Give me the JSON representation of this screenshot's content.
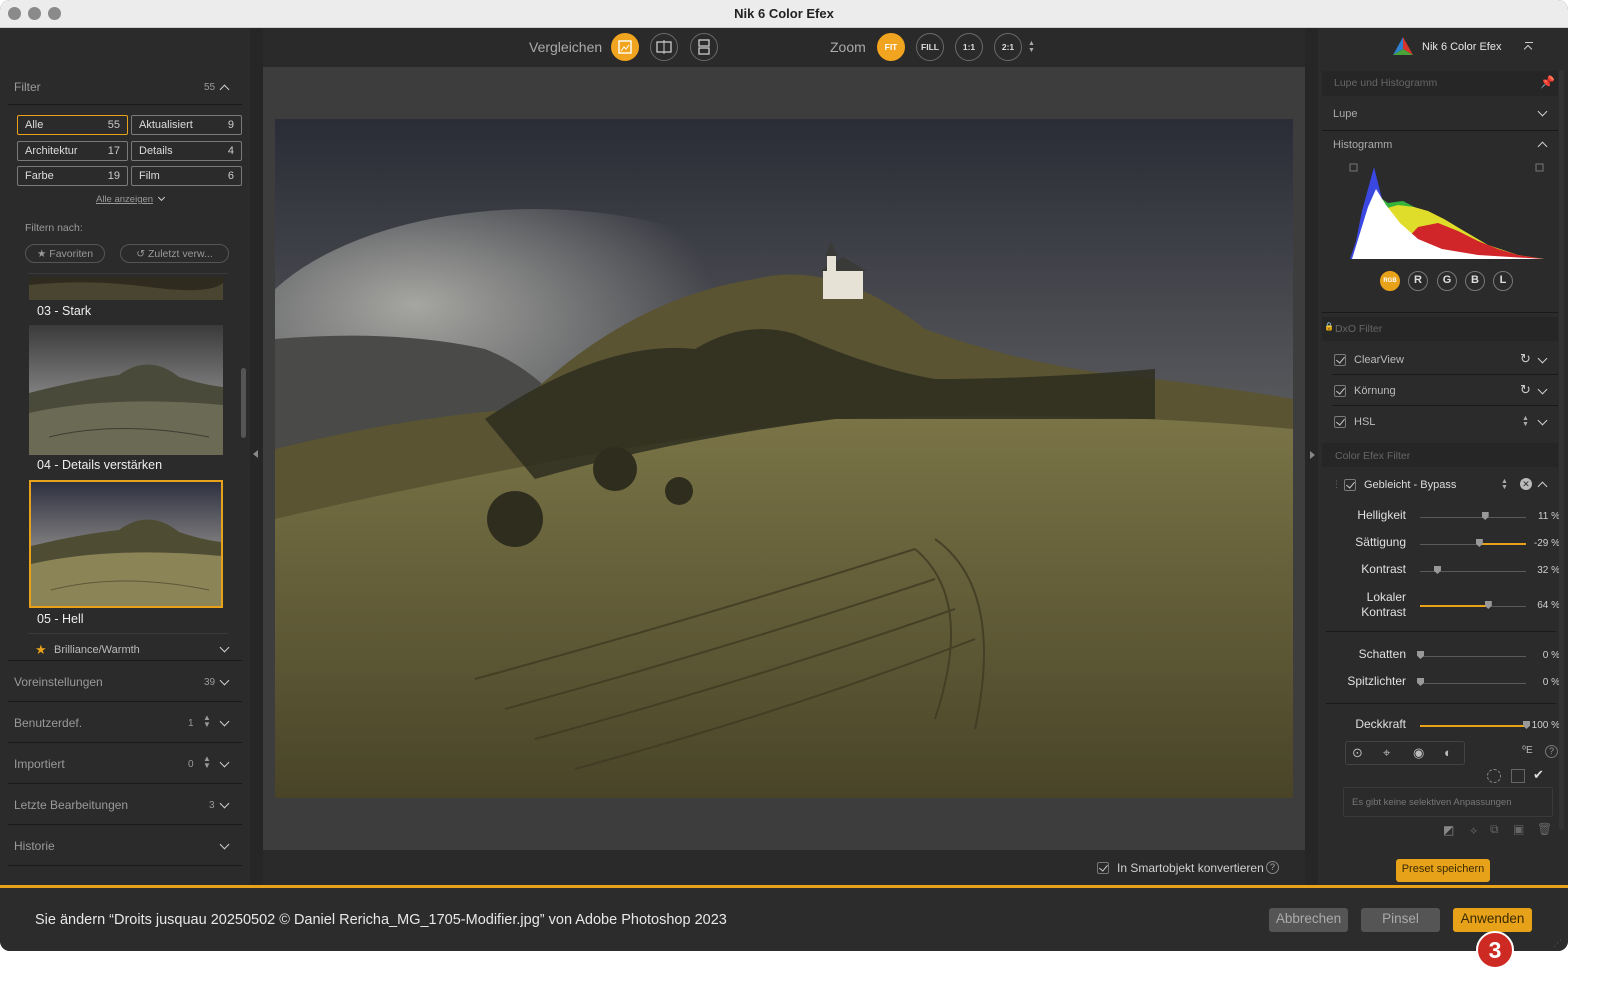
{
  "window": {
    "title": "Nik 6 Color Efex"
  },
  "left": {
    "filter_header": "Filter",
    "filter_count": "55",
    "categories": [
      {
        "label": "Alle",
        "count": "55",
        "selected": true
      },
      {
        "label": "Aktualisiert",
        "count": "9"
      },
      {
        "label": "Architektur",
        "count": "17"
      },
      {
        "label": "Details",
        "count": "4"
      },
      {
        "label": "Farbe",
        "count": "19"
      },
      {
        "label": "Film",
        "count": "6"
      }
    ],
    "show_all": "Alle anzeigen",
    "filter_by": "Filtern nach:",
    "favorites": "Favoriten",
    "recent": "Zuletzt verw...",
    "presets": [
      {
        "caption": "03 - Stark"
      },
      {
        "caption": "04 - Details verstärken"
      },
      {
        "caption": "05 - Hell",
        "selected": true
      }
    ],
    "group_label": "Brilliance/Warmth",
    "sections": [
      {
        "label": "Voreinstellungen",
        "count": "39"
      },
      {
        "label": "Benutzerdef.",
        "count": "1"
      },
      {
        "label": "Importiert",
        "count": "0"
      },
      {
        "label": "Letzte Bearbeitungen",
        "count": "3"
      },
      {
        "label": "Historie",
        "count": ""
      }
    ]
  },
  "center": {
    "compare_label": "Vergleichen",
    "zoom_label": "Zoom",
    "zoom_options": [
      "FIT",
      "FILL",
      "1:1",
      "2:1"
    ],
    "smart_object": "In Smartobjekt konvertieren"
  },
  "right": {
    "app_name": "Nik 6 Color Efex",
    "loupe_section": "Lupe und Histogramm",
    "loupe": "Lupe",
    "histogram": "Histogramm",
    "channels": [
      "RGB",
      "R",
      "G",
      "B",
      "L"
    ],
    "dxo_section": "DxO Filter",
    "dxo_filters": [
      "ClearView",
      "Körnung",
      "HSL"
    ],
    "cef_section": "Color Efex Filter",
    "active_filter": "Gebleicht - Bypass",
    "sliders": [
      {
        "label": "Helligkeit",
        "value": "11 %",
        "level": 0.61
      },
      {
        "label": "Sättigung",
        "value": "-29 %",
        "level": 0.555
      },
      {
        "label": "Kontrast",
        "value": "32 %",
        "level": 0.16
      },
      {
        "label": "Lokaler Kontrast",
        "label1": "Lokaler",
        "label2": "Kontrast",
        "value": "64 %",
        "level": 0.64
      },
      {
        "label": "Schatten",
        "value": "0 %",
        "level": 0
      },
      {
        "label": "Spitzlichter",
        "value": "0 %",
        "level": 0
      },
      {
        "label": "Deckkraft",
        "value": "100 %",
        "level": 1.0
      }
    ],
    "no_selective": "Es gibt keine selektiven Anpassungen",
    "save_preset": "Preset speichern"
  },
  "bottom": {
    "message": "Sie ändern “Droits jusquau 20250502 © Daniel Rericha_MG_1705-Modifier.jpg” von Adobe Photoshop 2023",
    "cancel": "Abbrechen",
    "brush": "Pinsel",
    "apply": "Anwenden",
    "step_badge": "3"
  },
  "colors": {
    "accent": "#e8a21a",
    "badge": "#cc2a22"
  }
}
